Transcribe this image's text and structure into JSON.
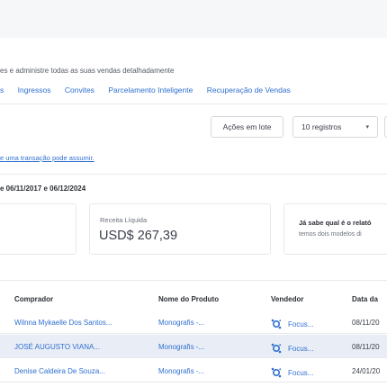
{
  "header": {
    "subtitle": "es e administre todas as suas vendas detalhadamente"
  },
  "nav": {
    "tabs": [
      "s",
      "Ingressos",
      "Convites",
      "Parcelamento Inteligente",
      "Recuperação de Vendas"
    ]
  },
  "toolbar": {
    "actions_label": "Ações em lote",
    "records_label": "10 registros",
    "records_caret": "▾"
  },
  "info": {
    "link_text": "e uma transação pode assumir."
  },
  "period": {
    "text": "e 06/11/2017 e 06/12/2024"
  },
  "summary": {
    "net_revenue_label": "Receita Líquida",
    "net_revenue_value": "USD$ 267,39",
    "tip_title": "Já sabe qual é o relató",
    "tip_body": "temos dois modelos di"
  },
  "table": {
    "headers": [
      "Comprador",
      "Nome do Produto",
      "Vendedor",
      "Data da"
    ],
    "rows": [
      {
        "buyer": "Wilnna Mykaelle Dos Santos...",
        "product": "Monografis -...",
        "seller": "Focus...",
        "date": "08/11/20"
      },
      {
        "buyer": "JOSÉ AUGUSTO VIANA...",
        "product": "Monografis -...",
        "seller": "Focus...",
        "date": "08/11/20"
      },
      {
        "buyer": "Denise Caldeira De Souza...",
        "product": "Monografis -...",
        "seller": "Focus...",
        "date": "24/01/20"
      }
    ]
  },
  "colors": {
    "link": "#2f6fd0",
    "highlight_row": "#e9edf6"
  }
}
